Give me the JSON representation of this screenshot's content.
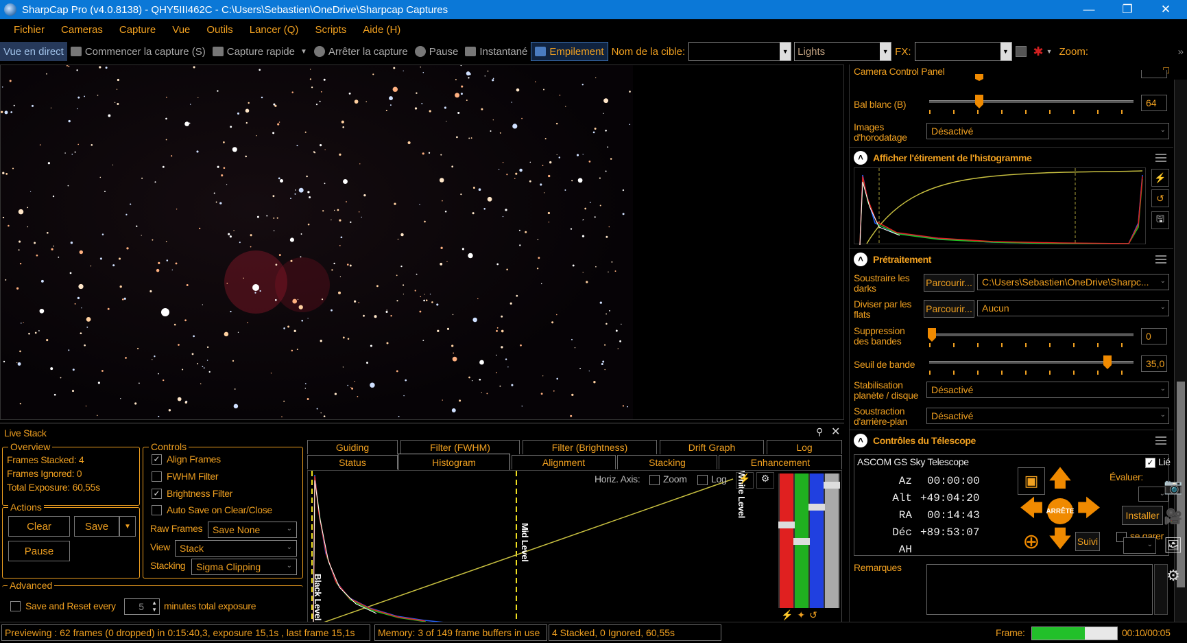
{
  "window": {
    "title": "SharpCap Pro (v4.0.8138) - QHY5III462C - C:\\Users\\Sebastien\\OneDrive\\Sharpcap Captures"
  },
  "menu": [
    "Fichier",
    "Cameras",
    "Capture",
    "Vue",
    "Outils",
    "Lancer (Q)",
    "Scripts",
    "Aide (H)"
  ],
  "toolbar": {
    "live_view": "Vue en direct",
    "start_capture": "Commencer la capture (S)",
    "quick_capture": "Capture rapide",
    "stop_capture": "Arrêter la capture",
    "pause": "Pause",
    "snapshot": "Instantané",
    "stacking": "Empilement",
    "target_label": "Nom de la cible:",
    "target_value": "",
    "frame_type": "Lights",
    "fx_label": "FX:",
    "fx_value": "",
    "zoom_label": "Zoom:"
  },
  "camera_panel": {
    "title": "Camera Control Panel",
    "white_balance_b": {
      "label": "Bal blanc (B)",
      "value": "64"
    },
    "timestamp": {
      "label1": "Images",
      "label2": "d'horodatage",
      "value": "Désactivé"
    },
    "histogram_section": "Afficher l'étirement de l'histogramme",
    "preprocessing_section": "Prétraitement",
    "darks": {
      "label1": "Soustraire les",
      "label2": "darks",
      "browse": "Parcourir...",
      "value": "C:\\Users\\Sebastien\\OneDrive\\Sharpc..."
    },
    "flats": {
      "label1": "Diviser par les",
      "label2": "flats",
      "browse": "Parcourir...",
      "value": "Aucun"
    },
    "banding": {
      "label1": "Suppression",
      "label2": "des bandes",
      "value": "0"
    },
    "band_threshold": {
      "label": "Seuil de bande",
      "value": "35,0"
    },
    "stabilization": {
      "label1": "Stabilisation",
      "label2": "planète / disque",
      "value": "Désactivé"
    },
    "background": {
      "label1": "Soustraction",
      "label2": "d'arrière-plan",
      "value": "Désactivé"
    },
    "telescope_section": "Contrôles du Télescope",
    "telescope": {
      "name": "ASCOM GS Sky Telescope",
      "linked": "Lié",
      "az_label": "Az",
      "az": "00:00:00",
      "alt_label": "Alt",
      "alt": "+49:04:20",
      "ra_label": "RA",
      "ra": "00:14:43",
      "dec_label": "Déc",
      "dec": "+89:53:07",
      "ah_label": "AH",
      "ah": "",
      "stop": "ARRÊTE",
      "evaluate": "Évaluer:",
      "install": "Installer",
      "park": "se garer",
      "follow": "Suivi"
    },
    "remarks": "Remarques"
  },
  "live_stack": {
    "title": "Live Stack",
    "overview": {
      "title": "Overview",
      "stacked": "Frames Stacked: 4",
      "ignored": "Frames Ignored:  0",
      "exposure": "Total Exposure:  60,55s"
    },
    "actions": {
      "title": "Actions",
      "clear": "Clear",
      "save": "Save",
      "pause": "Pause"
    },
    "controls": {
      "title": "Controls",
      "align": "Align Frames",
      "fwhm": "FWHM Filter",
      "brightness": "Brightness Filter",
      "autosave": "Auto Save on Clear/Close",
      "raw_label": "Raw Frames",
      "raw_value": "Save None",
      "view_label": "View",
      "view_value": "Stack",
      "stacking_label": "Stacking",
      "stacking_value": "Sigma Clipping"
    },
    "advanced": {
      "title": "Advanced",
      "save_reset": "Save and Reset every",
      "minutes": "5",
      "suffix": "minutes total exposure"
    },
    "tabs_row1": [
      "Guiding",
      "Filter (FWHM)",
      "Filter (Brightness)",
      "Drift Graph",
      "Log"
    ],
    "tabs_row2": [
      "Status",
      "Histogram",
      "Alignment",
      "Stacking",
      "Enhancement"
    ],
    "histogram": {
      "horiz_axis": "Horiz. Axis:",
      "zoom": "Zoom",
      "log": "Log",
      "black_level": "Black Level",
      "mid_level": "Mid Level",
      "white_level": "White Level"
    }
  },
  "status": {
    "preview": "Previewing : 62 frames (0 dropped) in 0:15:40,3, exposure 15,1s , last frame 15,1s",
    "memory": "Memory: 3 of 149 frame buffers in use",
    "stack": "4 Stacked, 0 Ignored, 60,55s",
    "frame_label": "Frame:",
    "frame_time": "00:10/00:05",
    "frame_progress": 0.62
  },
  "colors": {
    "accent": "#f0a020",
    "titlebar": "#0b78d7",
    "progress": "#22c02a"
  }
}
